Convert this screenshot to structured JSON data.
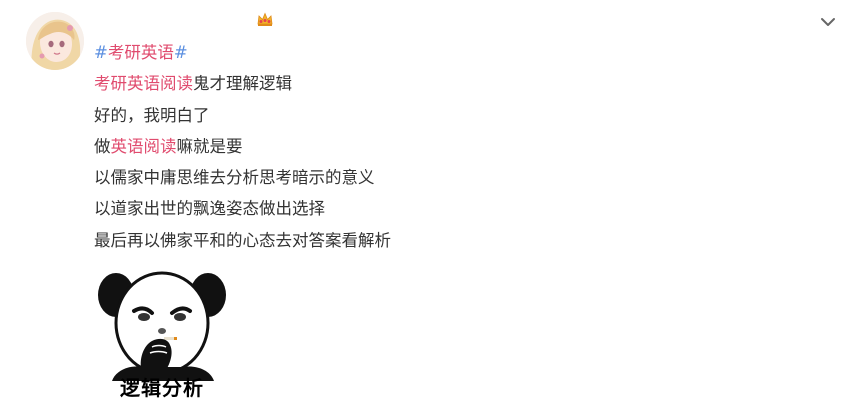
{
  "post": {
    "topic": {
      "prefix": "#",
      "text": "考研英语",
      "suffix": "#"
    },
    "line1": {
      "link": "考研英语阅读",
      "rest": "鬼才理解逻辑"
    },
    "line2": "好的，我明白了",
    "line3": {
      "pre": "做",
      "link": "英语阅读",
      "rest": "嘛就是要"
    },
    "line4": "以儒家中庸思维去分析思考暗示的意义",
    "line5": "以道家出世的飘逸姿态做出选择",
    "line6": "最后再以佛家平和的心态去对答案看解析"
  },
  "meme": {
    "caption": "逻辑分析"
  },
  "icons": {
    "avatar": "anime-avatar",
    "badge": "crown-icon",
    "expand": "chevron-down-icon"
  },
  "colors": {
    "tag": "#e04b6e",
    "hash": "#5b8fe0",
    "text": "#333333"
  }
}
